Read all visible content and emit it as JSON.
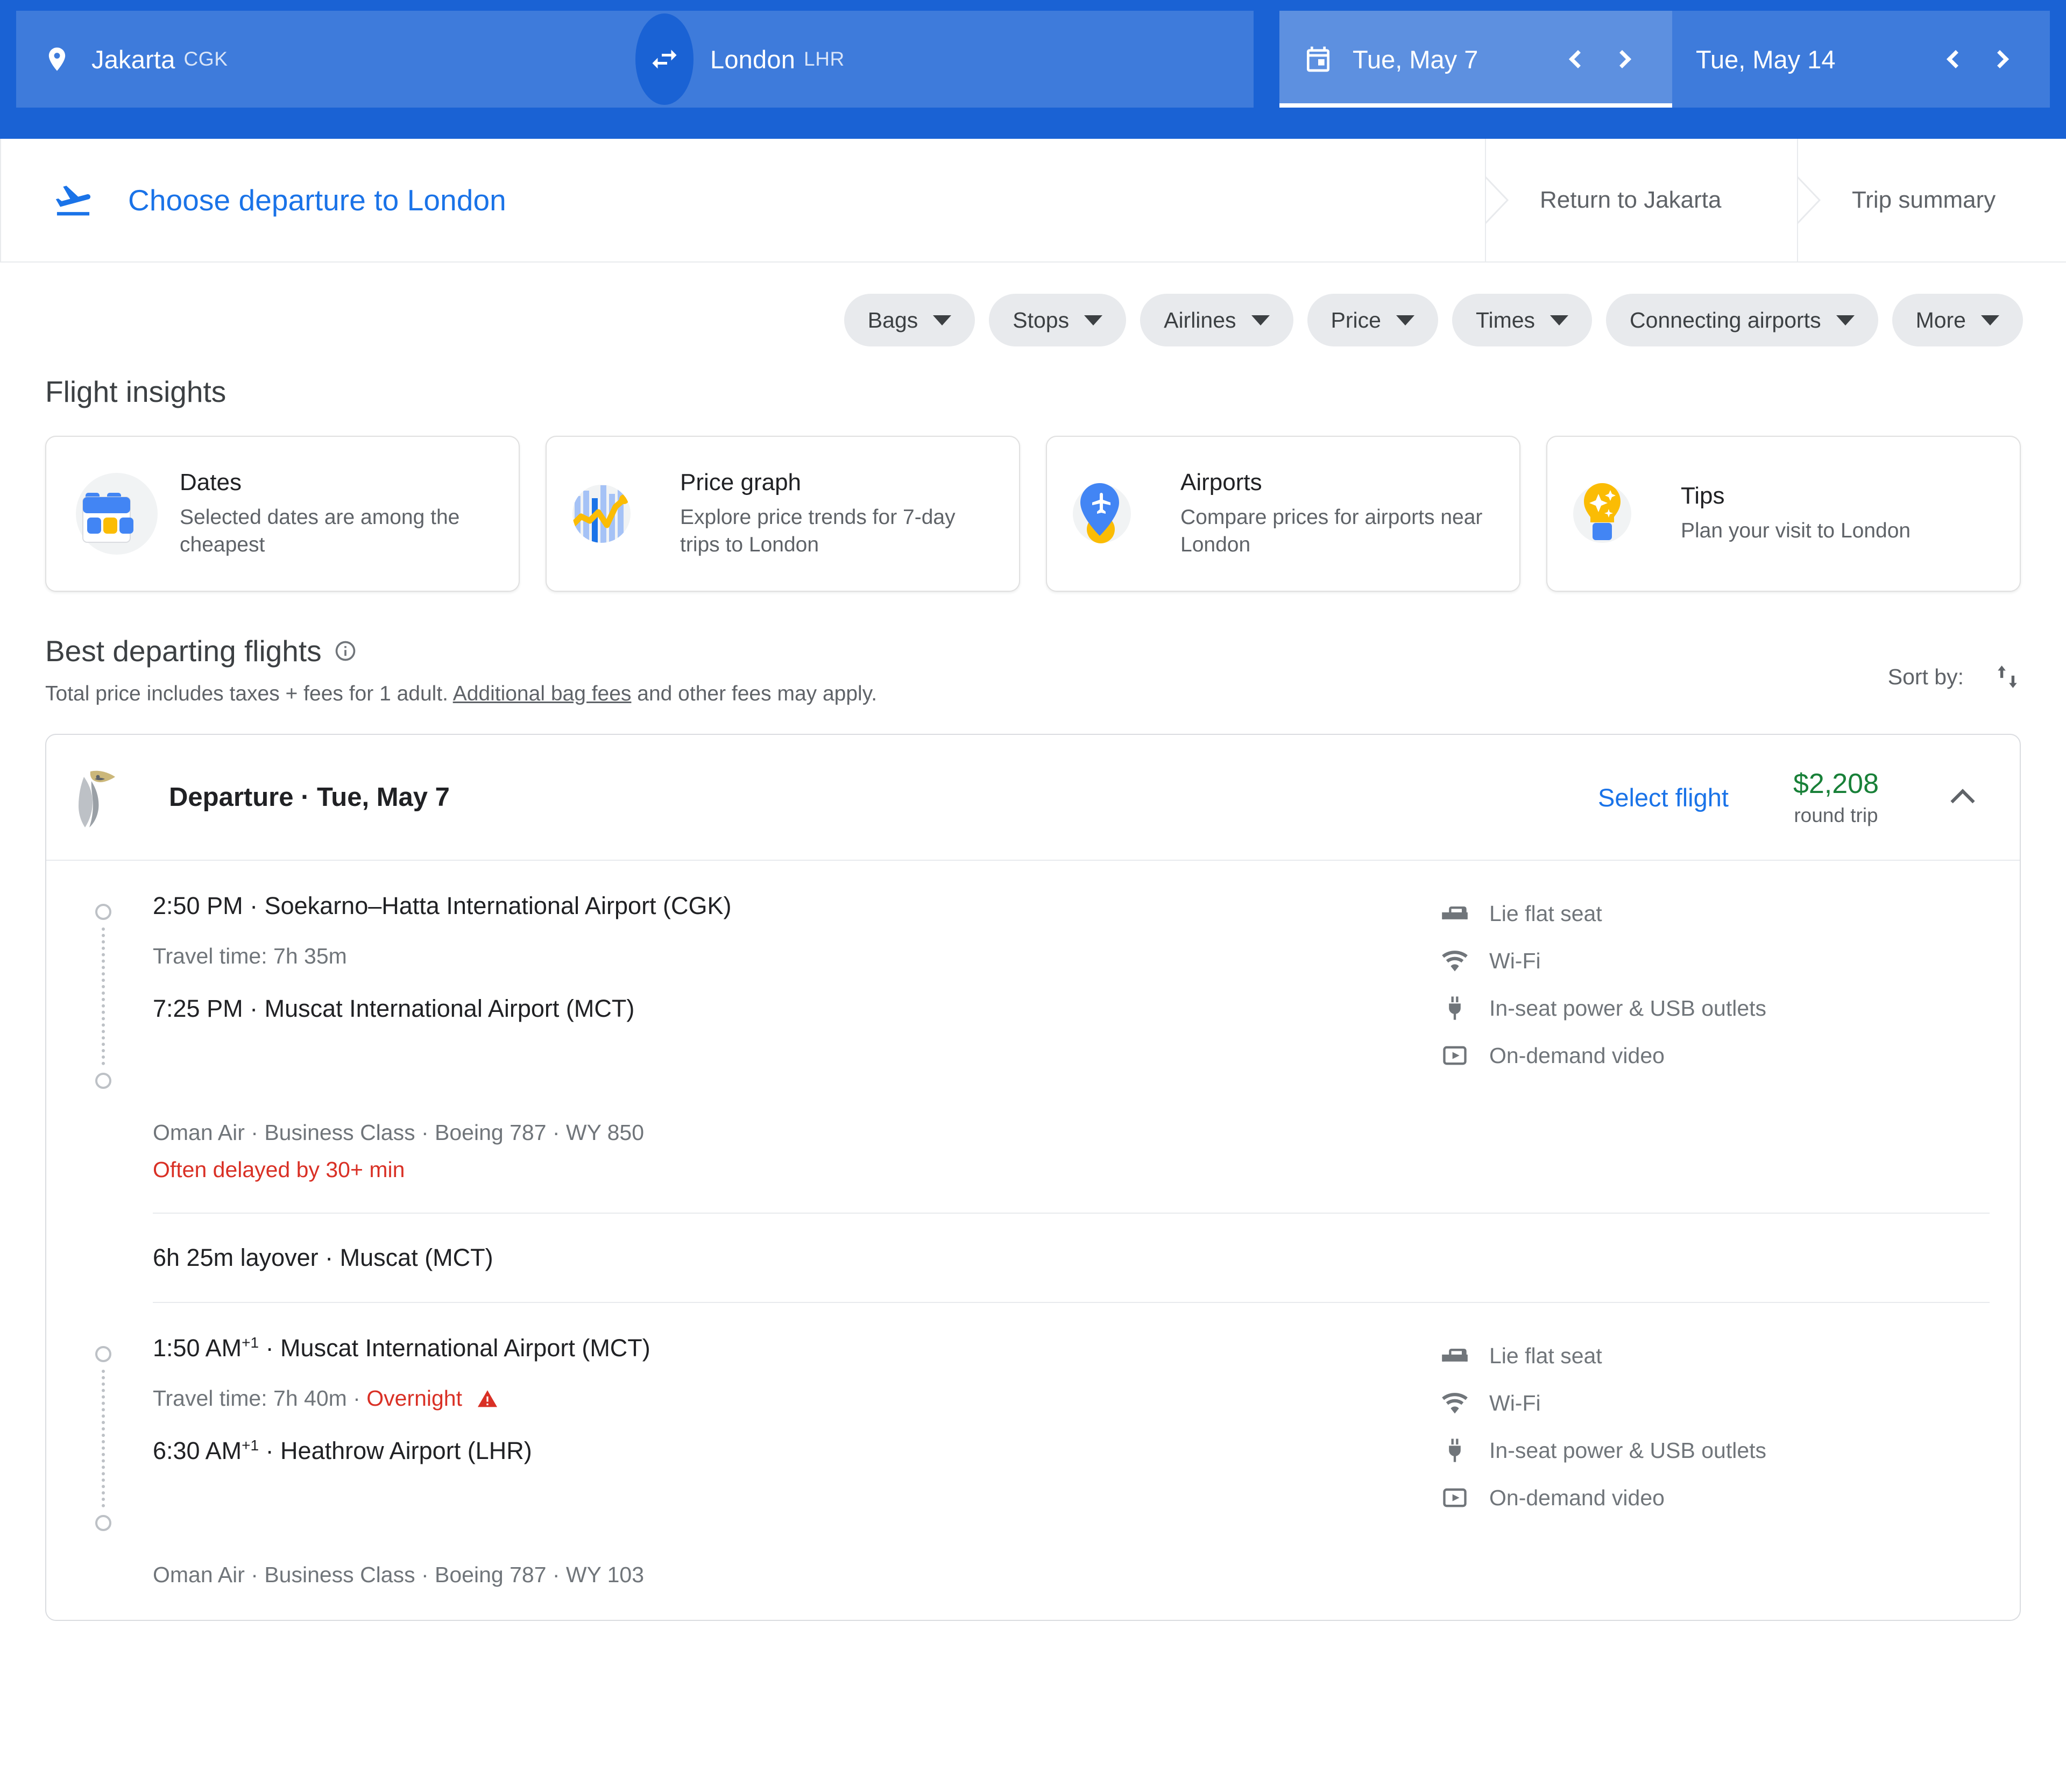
{
  "search": {
    "origin": {
      "city": "Jakarta",
      "code": "CGK"
    },
    "destination": {
      "city": "London",
      "code": "LHR"
    },
    "swap_icon": "swap-horizontal-icon",
    "depart_date": "Tue, May 7",
    "return_date": "Tue, May 14",
    "calendar_icon": "calendar-icon"
  },
  "tabs": {
    "active": {
      "label": "Choose departure to London",
      "icon": "flight-takeoff-icon"
    },
    "crumbs": [
      {
        "label": "Return to Jakarta"
      },
      {
        "label": "Trip summary"
      }
    ]
  },
  "filters": [
    {
      "label": "Bags"
    },
    {
      "label": "Stops"
    },
    {
      "label": "Airlines"
    },
    {
      "label": "Price"
    },
    {
      "label": "Times"
    },
    {
      "label": "Connecting airports"
    },
    {
      "label": "More"
    }
  ],
  "insights": {
    "title": "Flight insights",
    "cards": [
      {
        "icon": "calendar-dates-icon",
        "title": "Dates",
        "subtitle": "Selected dates are among the cheapest"
      },
      {
        "icon": "price-graph-icon",
        "title": "Price graph",
        "subtitle": "Explore price trends for 7-day trips to London"
      },
      {
        "icon": "airport-pin-icon",
        "title": "Airports",
        "subtitle": "Compare prices for airports near London"
      },
      {
        "icon": "lightbulb-tips-icon",
        "title": "Tips",
        "subtitle": "Plan your visit to London"
      }
    ]
  },
  "best_departing": {
    "title": "Best departing flights",
    "info_icon": "info-icon",
    "disclaimer_pre": "Total price includes taxes + fees for 1 adult. ",
    "disclaimer_link": "Additional bag fees",
    "disclaimer_post": " and other fees may apply.",
    "sort_label": "Sort by:",
    "sort_icon": "sort-arrows-icon"
  },
  "flight_card": {
    "airline_logo": "oman-air-logo",
    "header_title": "Departure · Tue, May 7",
    "select_label": "Select flight",
    "price": "$2,208",
    "price_sub": "round trip",
    "collapse_icon": "chevron-up-icon",
    "legs": [
      {
        "depart_time": "2:50 PM",
        "depart_sup": "",
        "depart_place": "· Soekarno–Hatta International Airport (CGK)",
        "travel_time": "Travel time: 7h 35m",
        "overnight": "",
        "arrive_time": "7:25 PM",
        "arrive_sup": "",
        "arrive_place": "· Muscat International Airport (MCT)",
        "meta": "Oman Air · Business Class · Boeing 787 · WY 850",
        "delay_warning": "Often delayed by 30+ min",
        "amenities": [
          {
            "icon": "lie-flat-seat-icon",
            "label": "Lie flat seat"
          },
          {
            "icon": "wifi-icon",
            "label": "Wi-Fi"
          },
          {
            "icon": "power-plug-icon",
            "label": "In-seat power & USB outlets"
          },
          {
            "icon": "video-player-icon",
            "label": "On-demand video"
          }
        ]
      },
      {
        "depart_time": "1:50 AM",
        "depart_sup": "+1",
        "depart_place": "· Muscat International Airport (MCT)",
        "travel_time": "Travel time: 7h 40m · ",
        "overnight": "Overnight",
        "arrive_time": "6:30 AM",
        "arrive_sup": "+1",
        "arrive_place": "· Heathrow Airport (LHR)",
        "meta": "Oman Air · Business Class · Boeing 787 · WY 103",
        "delay_warning": "",
        "amenities": [
          {
            "icon": "lie-flat-seat-icon",
            "label": "Lie flat seat"
          },
          {
            "icon": "wifi-icon",
            "label": "Wi-Fi"
          },
          {
            "icon": "power-plug-icon",
            "label": "In-seat power & USB outlets"
          },
          {
            "icon": "video-player-icon",
            "label": "On-demand video"
          }
        ]
      }
    ],
    "layover": "6h 25m layover · Muscat (MCT)"
  },
  "colors": {
    "brand_blue": "#1a73e8",
    "header_blue": "#1a62d4",
    "price_green": "#188038",
    "warning_red": "#d93025",
    "chip_grey": "#e8eaed"
  }
}
